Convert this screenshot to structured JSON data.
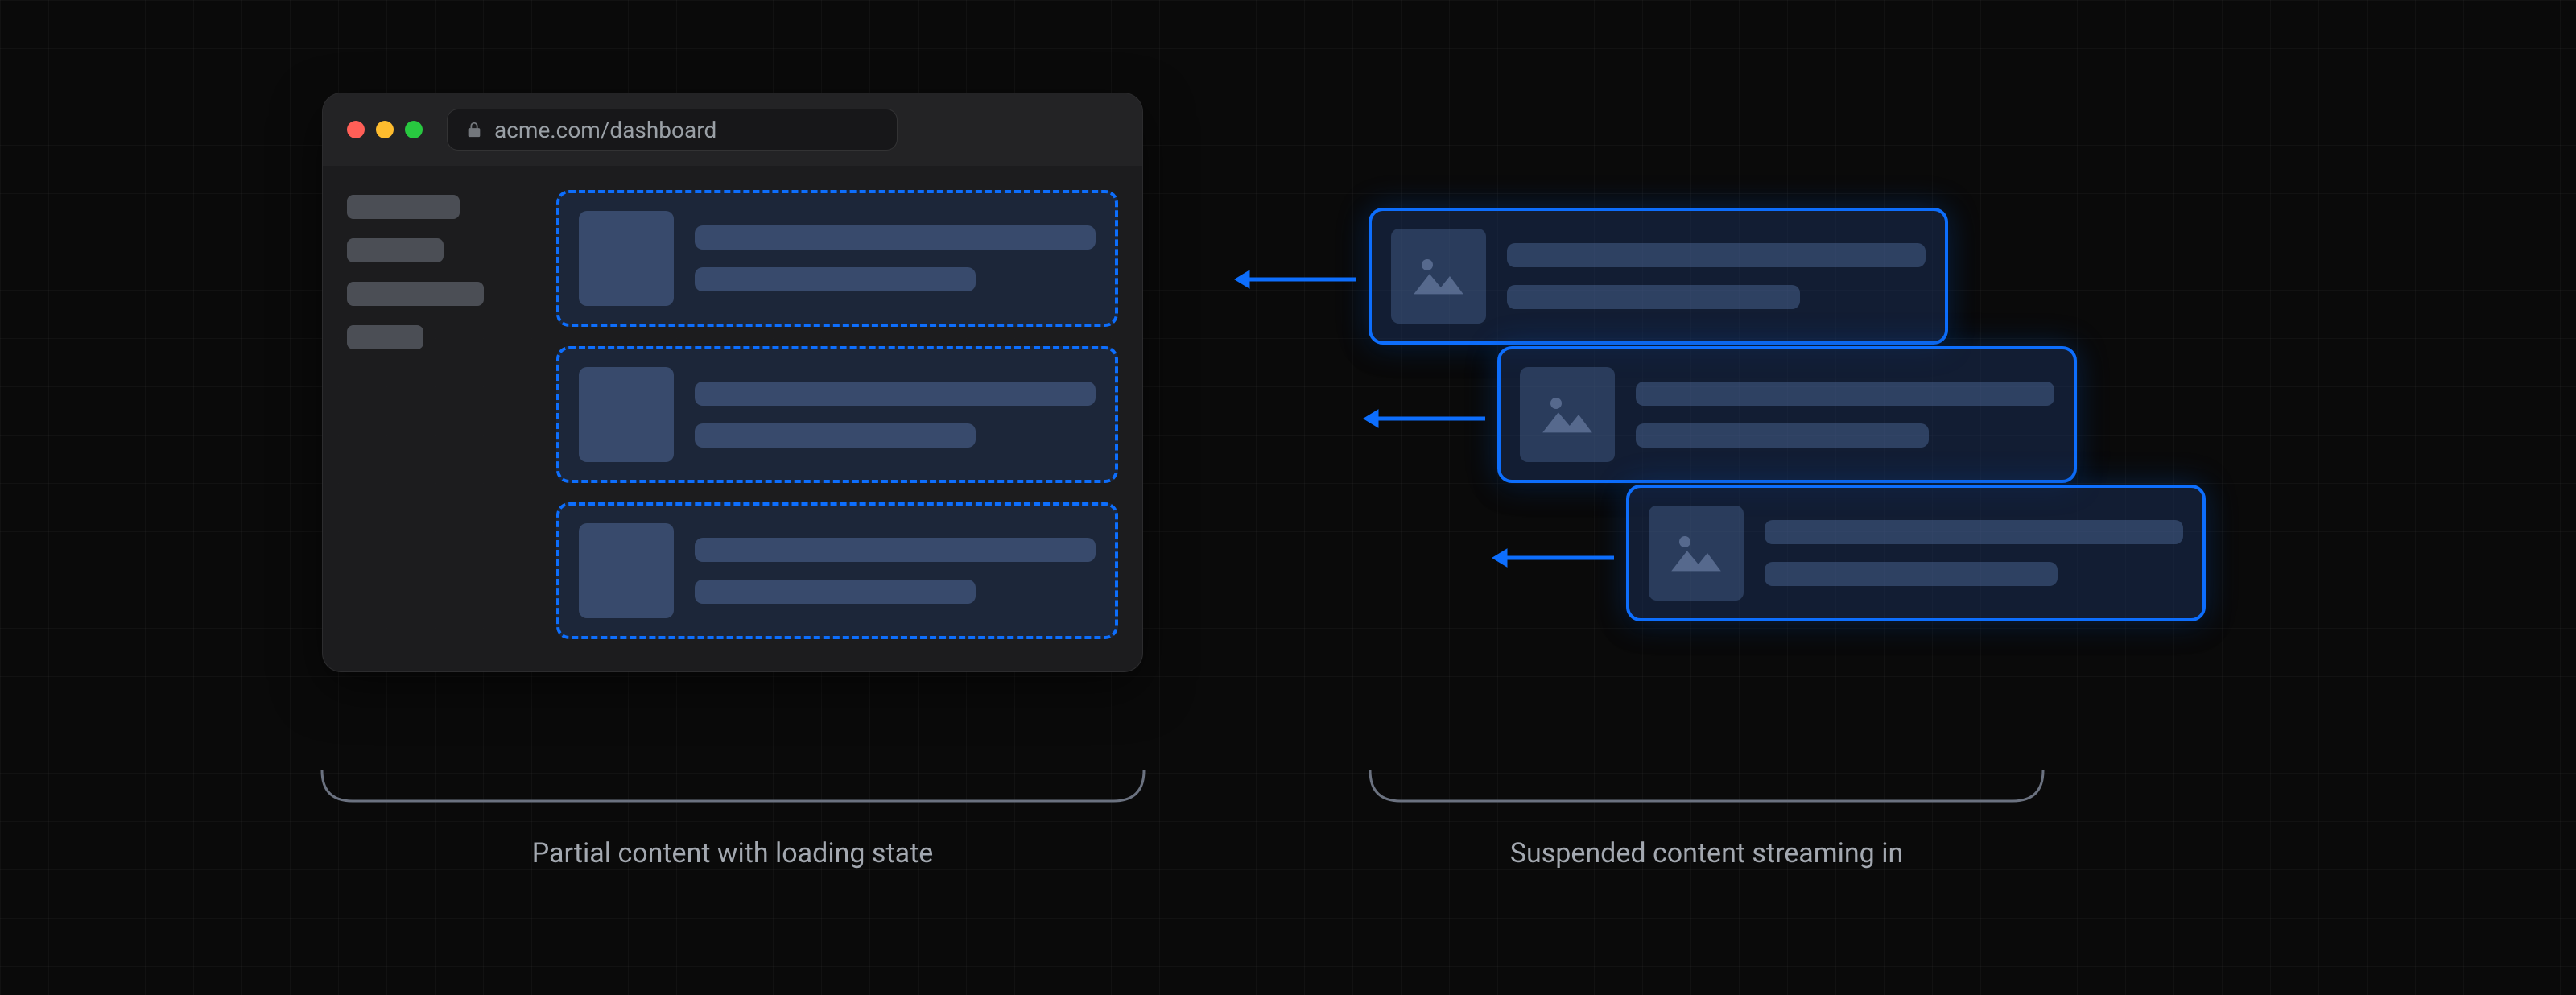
{
  "browser": {
    "url": "acme.com/dashboard"
  },
  "captions": {
    "left": "Partial content with loading state",
    "right": "Suspended content streaming in"
  },
  "colors": {
    "accent": "#0d6efd",
    "caption": "#a3a8b0",
    "background": "#0a0a0a"
  },
  "sidebar": {
    "item_count": 4
  },
  "skeleton_cards": 3,
  "streaming_cards": 3
}
